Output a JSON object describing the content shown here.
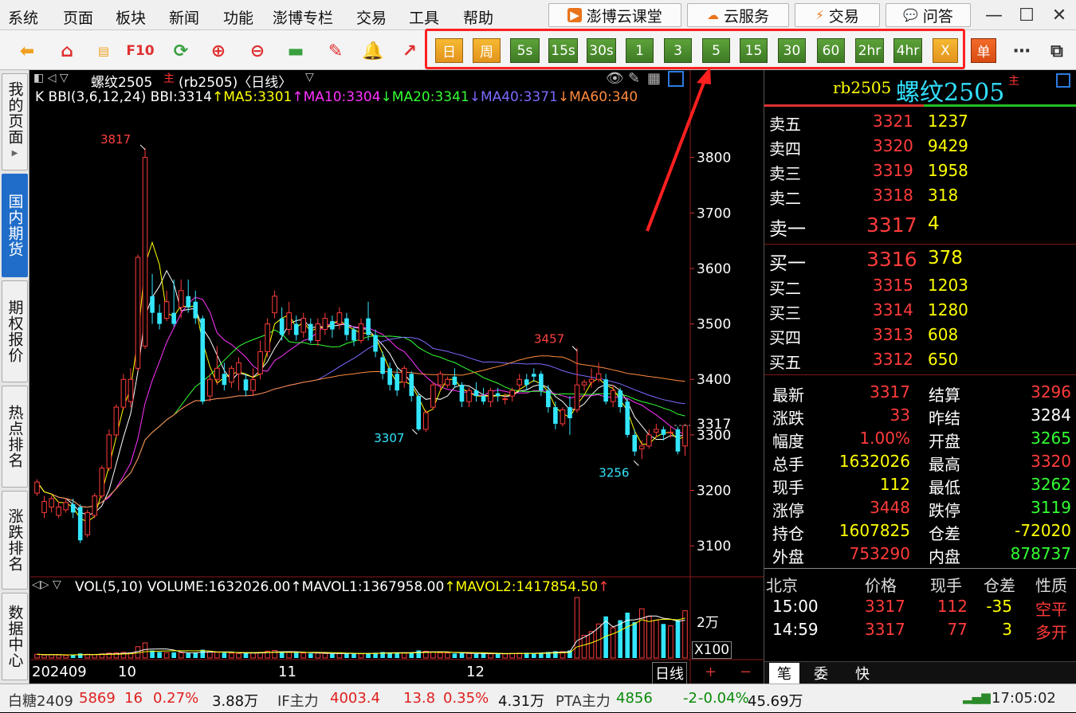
{
  "menu": [
    "系统",
    "页面",
    "板块",
    "新闻",
    "功能",
    "澎博专栏",
    "交易",
    "工具",
    "帮助"
  ],
  "top_buttons": [
    "澎博云课堂",
    "云服务",
    "交易",
    "问答"
  ],
  "periods": [
    "日",
    "周",
    "5s",
    "15s",
    "30s",
    "1",
    "3",
    "5",
    "15",
    "30",
    "60",
    "2hr",
    "4hr",
    "X",
    "单"
  ],
  "sidebar_tabs": [
    "我的页面",
    "国内期货",
    "期权报价",
    "热点排名",
    "涨跌排名",
    "数据中心"
  ],
  "chart": {
    "title": "螺纹2505",
    "main_mark": "主",
    "subtitle": "(rb2505)〈日线〉",
    "indicator_line": [
      {
        "text": "K BBI(3,6,12,24) BBI:3314",
        "color": "#ffffff"
      },
      {
        "text": "↑MA5:3301",
        "color": "#ffff00"
      },
      {
        "text": "↑MA10:3304",
        "color": "#ff33ff"
      },
      {
        "text": "↓MA20:3341",
        "color": "#33ff33"
      },
      {
        "text": "↓MA40:3371",
        "color": "#7a6bff"
      },
      {
        "text": "↓MA60:340",
        "color": "#ff8a3c"
      }
    ],
    "price_ticks": [
      "3800",
      "3700",
      "3600",
      "3500",
      "3400",
      "3300",
      "3200",
      "3100"
    ],
    "price_tag": "3317",
    "annotations": {
      "high": "3817",
      "p3457": "3457",
      "p3307": "3307",
      "p3256": "3256"
    },
    "vol_line": [
      {
        "text": "VOL(5,10) VOLUME:1632026.00",
        "color": "#ffffff"
      },
      {
        "text": "↑MAVOL1:1367958.00",
        "color": "#ffffff"
      },
      {
        "text": "↑MAVOL2:1417854.50",
        "color": "#ffff00"
      },
      {
        "text": "↑",
        "color": "#ff4040"
      }
    ],
    "vol_tick": "2万",
    "vol_unit": "X100",
    "date_labels": [
      "202409",
      "10",
      "11",
      "12"
    ],
    "period_label": "日线",
    "zoom_buttons": [
      "+",
      "−"
    ]
  },
  "chart_data": {
    "type": "candlestick",
    "series": [
      {
        "name": "K",
        "values": [
          [
            3195,
            3215,
            3220,
            3190
          ],
          [
            3160,
            3180,
            3190,
            3150
          ],
          [
            3170,
            3185,
            3190,
            3160
          ],
          [
            3155,
            3170,
            3180,
            3150
          ],
          [
            3165,
            3178,
            3185,
            3160
          ],
          [
            3175,
            3160,
            3185,
            3150
          ],
          [
            3170,
            3110,
            3175,
            3105
          ],
          [
            3120,
            3160,
            3165,
            3115
          ],
          [
            3155,
            3190,
            3195,
            3150
          ],
          [
            3190,
            3240,
            3245,
            3185
          ],
          [
            3240,
            3300,
            3310,
            3235
          ],
          [
            3300,
            3350,
            3355,
            3295
          ],
          [
            3350,
            3400,
            3410,
            3345
          ],
          [
            3360,
            3400,
            3420,
            3350
          ],
          [
            3420,
            3620,
            3625,
            3415
          ],
          [
            3460,
            3800,
            3817,
            3455
          ],
          [
            3550,
            3520,
            3590,
            3500
          ],
          [
            3520,
            3500,
            3535,
            3490
          ],
          [
            3510,
            3540,
            3560,
            3505
          ],
          [
            3520,
            3500,
            3580,
            3495
          ],
          [
            3530,
            3560,
            3580,
            3510
          ],
          [
            3550,
            3530,
            3580,
            3520
          ],
          [
            3540,
            3510,
            3560,
            3500
          ],
          [
            3510,
            3360,
            3515,
            3355
          ],
          [
            3370,
            3400,
            3410,
            3360
          ],
          [
            3400,
            3420,
            3460,
            3390
          ],
          [
            3410,
            3390,
            3430,
            3380
          ],
          [
            3395,
            3420,
            3425,
            3385
          ],
          [
            3410,
            3430,
            3440,
            3380
          ],
          [
            3400,
            3380,
            3410,
            3370
          ],
          [
            3380,
            3400,
            3420,
            3370
          ],
          [
            3410,
            3450,
            3470,
            3400
          ],
          [
            3450,
            3500,
            3510,
            3440
          ],
          [
            3520,
            3550,
            3560,
            3510
          ],
          [
            3510,
            3480,
            3530,
            3470
          ],
          [
            3490,
            3520,
            3540,
            3480
          ],
          [
            3500,
            3480,
            3515,
            3470
          ],
          [
            3485,
            3510,
            3520,
            3475
          ],
          [
            3500,
            3470,
            3510,
            3465
          ],
          [
            3470,
            3500,
            3510,
            3460
          ],
          [
            3490,
            3510,
            3520,
            3480
          ],
          [
            3505,
            3490,
            3515,
            3475
          ],
          [
            3500,
            3520,
            3530,
            3490
          ],
          [
            3510,
            3480,
            3520,
            3470
          ],
          [
            3490,
            3470,
            3495,
            3460
          ],
          [
            3470,
            3500,
            3510,
            3465
          ],
          [
            3510,
            3480,
            3540,
            3470
          ],
          [
            3480,
            3450,
            3490,
            3440
          ],
          [
            3440,
            3410,
            3450,
            3400
          ],
          [
            3420,
            3390,
            3430,
            3380
          ],
          [
            3410,
            3380,
            3420,
            3370
          ],
          [
            3395,
            3420,
            3425,
            3385
          ],
          [
            3410,
            3370,
            3415,
            3360
          ],
          [
            3370,
            3310,
            3375,
            3307
          ],
          [
            3310,
            3340,
            3345,
            3305
          ],
          [
            3350,
            3390,
            3395,
            3345
          ],
          [
            3390,
            3410,
            3415,
            3380
          ],
          [
            3390,
            3400,
            3405,
            3385
          ],
          [
            3405,
            3390,
            3420,
            3385
          ],
          [
            3390,
            3360,
            3395,
            3350
          ],
          [
            3360,
            3380,
            3385,
            3350
          ],
          [
            3380,
            3370,
            3395,
            3360
          ],
          [
            3370,
            3360,
            3385,
            3355
          ],
          [
            3360,
            3380,
            3385,
            3350
          ],
          [
            3375,
            3370,
            3385,
            3360
          ],
          [
            3365,
            3365,
            3375,
            3355
          ],
          [
            3370,
            3380,
            3385,
            3360
          ],
          [
            3390,
            3400,
            3410,
            3380
          ],
          [
            3400,
            3390,
            3410,
            3380
          ],
          [
            3410,
            3405,
            3420,
            3395
          ],
          [
            3410,
            3380,
            3415,
            3370
          ],
          [
            3380,
            3350,
            3390,
            3340
          ],
          [
            3350,
            3320,
            3360,
            3310
          ],
          [
            3320,
            3345,
            3350,
            3315
          ],
          [
            3350,
            3330,
            3370,
            3300
          ],
          [
            3345,
            3390,
            3457,
            3340
          ],
          [
            3390,
            3395,
            3400,
            3380
          ],
          [
            3395,
            3400,
            3420,
            3385
          ],
          [
            3400,
            3410,
            3430,
            3395
          ],
          [
            3400,
            3360,
            3410,
            3355
          ],
          [
            3360,
            3380,
            3390,
            3350
          ],
          [
            3380,
            3350,
            3385,
            3340
          ],
          [
            3360,
            3300,
            3365,
            3295
          ],
          [
            3300,
            3270,
            3310,
            3262
          ],
          [
            3275,
            3280,
            3290,
            3256
          ],
          [
            3280,
            3300,
            3310,
            3275
          ],
          [
            3305,
            3310,
            3320,
            3295
          ],
          [
            3310,
            3300,
            3315,
            3290
          ],
          [
            3305,
            3305,
            3315,
            3295
          ],
          [
            3310,
            3270,
            3315,
            3265
          ],
          [
            3280,
            3317,
            3320,
            3262
          ]
        ]
      },
      {
        "name": "VOLUME",
        "values": [
          10,
          8,
          9,
          8,
          7,
          9,
          12,
          10,
          9,
          11,
          13,
          14,
          15,
          14,
          30,
          40,
          20,
          16,
          14,
          15,
          14,
          13,
          14,
          22,
          16,
          15,
          14,
          13,
          12,
          13,
          14,
          15,
          18,
          20,
          16,
          15,
          14,
          13,
          12,
          13,
          12,
          11,
          12,
          13,
          12,
          11,
          12,
          14,
          16,
          15,
          14,
          13,
          15,
          20,
          18,
          16,
          14,
          13,
          12,
          13,
          12,
          11,
          12,
          11,
          12,
          11,
          12,
          13,
          14,
          13,
          14,
          16,
          18,
          17,
          20,
          160,
          60,
          70,
          90,
          110,
          80,
          100,
          120,
          95,
          130,
          110,
          100,
          90,
          85,
          100,
          125
        ]
      }
    ],
    "last": {
      "price": 3317,
      "high": 3320,
      "low": 3262,
      "open": 3265
    },
    "ylim": [
      3050,
      3900
    ],
    "x_labels": [
      "202409",
      "10",
      "11",
      "12"
    ]
  },
  "quote": {
    "code": "rb2505",
    "name": "螺纹2505",
    "main_mark": "主",
    "asks": [
      {
        "label": "卖五",
        "price": "3321",
        "vol": "1237"
      },
      {
        "label": "卖四",
        "price": "3320",
        "vol": "9429"
      },
      {
        "label": "卖三",
        "price": "3319",
        "vol": "1958"
      },
      {
        "label": "卖二",
        "price": "3318",
        "vol": "318"
      },
      {
        "label": "卖一",
        "price": "3317",
        "vol": "4"
      }
    ],
    "bids": [
      {
        "label": "买一",
        "price": "3316",
        "vol": "378"
      },
      {
        "label": "买二",
        "price": "3315",
        "vol": "1203"
      },
      {
        "label": "买三",
        "price": "3314",
        "vol": "1280"
      },
      {
        "label": "买四",
        "price": "3313",
        "vol": "608"
      },
      {
        "label": "买五",
        "price": "3312",
        "vol": "650"
      }
    ],
    "stats_left": [
      {
        "label": "最新",
        "value": "3317",
        "color": "#ff3b3b"
      },
      {
        "label": "涨跌",
        "value": "33",
        "color": "#ff3b3b"
      },
      {
        "label": "幅度",
        "value": "1.00%",
        "color": "#ff3b3b"
      },
      {
        "label": "总手",
        "value": "1632026",
        "color": "#ffff00"
      },
      {
        "label": "现手",
        "value": "112",
        "color": "#ffff00"
      },
      {
        "label": "涨停",
        "value": "3448",
        "color": "#ff3b3b"
      },
      {
        "label": "持仓",
        "value": "1607825",
        "color": "#ffff00"
      },
      {
        "label": "外盘",
        "value": "753290",
        "color": "#ff3b3b"
      }
    ],
    "stats_right": [
      {
        "label": "结算",
        "value": "3296",
        "color": "#ff3b3b"
      },
      {
        "label": "昨结",
        "value": "3284",
        "color": "#ffffff"
      },
      {
        "label": "开盘",
        "value": "3265",
        "color": "#33ff33"
      },
      {
        "label": "最高",
        "value": "3320",
        "color": "#ff3b3b"
      },
      {
        "label": "最低",
        "value": "3262",
        "color": "#33ff33"
      },
      {
        "label": "跌停",
        "value": "3119",
        "color": "#33ff33"
      },
      {
        "label": "仓差",
        "value": "-72020",
        "color": "#ffff00"
      },
      {
        "label": "内盘",
        "value": "878737",
        "color": "#33ff33"
      }
    ],
    "ticks_header": [
      "北京",
      "价格",
      "现手",
      "仓差",
      "性质"
    ],
    "ticks": [
      {
        "time": "15:00",
        "price": "3317",
        "vol": "112",
        "oi": "-35",
        "nature": "空平"
      },
      {
        "time": "14:59",
        "price": "3317",
        "vol": "77",
        "oi": "3",
        "nature": "多开"
      }
    ],
    "bottom_tabs": [
      "笔",
      "委",
      "快"
    ]
  },
  "statusbar": {
    "items": [
      {
        "name": "白糖2409",
        "price": "5869",
        "chg": "16",
        "pct": "0.27%",
        "vol": "3.88万",
        "color": "#e02020"
      },
      {
        "name": "IF主力",
        "price": "4003.4",
        "chg": "13.8",
        "pct": "0.35%",
        "vol": "4.31万",
        "color": "#e02020"
      },
      {
        "name": "PTA主力",
        "price": "4856",
        "chg": "-2",
        "pct": "-0.04%",
        "vol": "45.69万",
        "color": "#0a8a0a"
      }
    ],
    "time": "17:05:02"
  }
}
